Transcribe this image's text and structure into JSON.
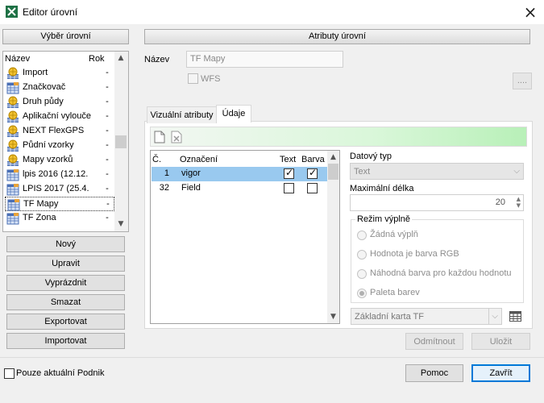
{
  "window": {
    "title": "Editor úrovní"
  },
  "left_panel": {
    "header": "Výběr úrovní",
    "columns": {
      "name": "Název",
      "year": "Rok"
    },
    "items": [
      {
        "name": "Import",
        "rok": "-",
        "icon": "globe-layer-icon"
      },
      {
        "name": "Značkovač",
        "rok": "-",
        "icon": "table-layer-icon"
      },
      {
        "name": "Druh půdy",
        "rok": "-",
        "icon": "globe-layer-icon"
      },
      {
        "name": "Aplikační vylouče",
        "rok": "-",
        "icon": "globe-layer-icon"
      },
      {
        "name": "NEXT FlexGPS",
        "rok": "-",
        "icon": "globe-layer-icon"
      },
      {
        "name": "Půdní vzorky",
        "rok": "-",
        "icon": "globe-layer-icon"
      },
      {
        "name": "Mapy vzorků",
        "rok": "-",
        "icon": "globe-layer-icon"
      },
      {
        "name": "lpis 2016 (12.12.",
        "rok": "-",
        "icon": "table-layer-icon"
      },
      {
        "name": "LPIS 2017 (25.4.",
        "rok": "-",
        "icon": "table-layer-icon"
      },
      {
        "name": "TF Mapy",
        "rok": "-",
        "icon": "table-layer-icon",
        "selected": true
      },
      {
        "name": "TF Zona",
        "rok": "-",
        "icon": "table-layer-icon"
      }
    ],
    "buttons": {
      "new": "Nový",
      "edit": "Upravit",
      "clear": "Vyprázdnit",
      "delete": "Smazat",
      "export": "Exportovat",
      "import": "Importovat"
    },
    "only_current_label": "Pouze aktuální Podnik"
  },
  "right_panel": {
    "header": "Atributy úrovní",
    "name_label": "Název",
    "name_value": "TF Mapy",
    "wfs_label": "WFS",
    "more_button": "....",
    "tabs": {
      "visual": "Vizuální atributy",
      "data": "Údaje"
    },
    "grid": {
      "columns": {
        "num": "Č.",
        "label": "Označení",
        "text": "Text",
        "color": "Barva"
      },
      "rows": [
        {
          "num": "1",
          "label": "vigor",
          "text": true,
          "color": true,
          "selected": true
        },
        {
          "num": "32",
          "label": "Field",
          "text": false,
          "color": false
        }
      ]
    },
    "data_type_label": "Datový typ",
    "data_type_value": "Text",
    "max_length_label": "Maximální délka",
    "max_length_value": "20",
    "fill_mode": {
      "title": "Režim výplně",
      "options": [
        "Žádná výplň",
        "Hodnota je barva RGB",
        "Náhodná barva pro každou hodnotu",
        "Paleta barev"
      ],
      "selected_index": 3,
      "palette_value": "Základní karta TF"
    },
    "reject_button": "Odmítnout",
    "save_button": "Uložit"
  },
  "footer": {
    "help_button": "Pomoc",
    "close_button": "Zavřít"
  }
}
